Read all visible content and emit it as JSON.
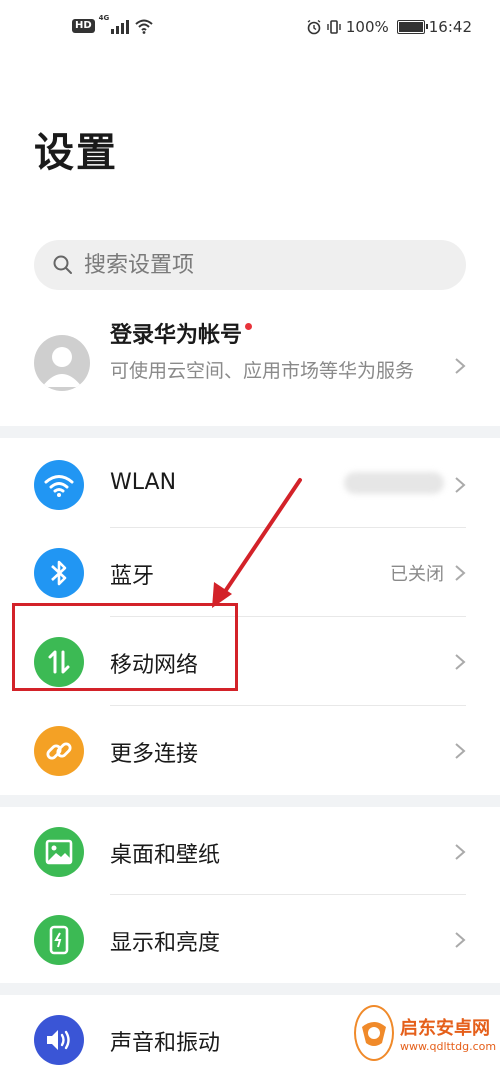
{
  "status_bar": {
    "hd": "HD",
    "network": "4G",
    "battery": "100%",
    "time": "16:42"
  },
  "page": {
    "title": "设置"
  },
  "search": {
    "placeholder": "搜索设置项"
  },
  "account": {
    "title": "登录华为帐号",
    "subtitle": "可使用云空间、应用市场等华为服务"
  },
  "settings_groups": [
    {
      "items": [
        {
          "label": "WLAN",
          "value": "",
          "icon": "wifi-icon",
          "color": "#2196f3"
        },
        {
          "label": "蓝牙",
          "value": "已关闭",
          "icon": "bluetooth-icon",
          "color": "#2196f3"
        },
        {
          "label": "移动网络",
          "value": "",
          "icon": "mobile-data-icon",
          "color": "#3cba54"
        },
        {
          "label": "更多连接",
          "value": "",
          "icon": "link-icon",
          "color": "#f4a125"
        }
      ]
    },
    {
      "items": [
        {
          "label": "桌面和壁纸",
          "value": "",
          "icon": "image-icon",
          "color": "#3cba54"
        },
        {
          "label": "显示和亮度",
          "value": "",
          "icon": "phone-display-icon",
          "color": "#3cba54"
        }
      ]
    },
    {
      "items": [
        {
          "label": "声音和振动",
          "value": "",
          "icon": "speaker-icon",
          "color": "#3a55d6"
        }
      ]
    }
  ],
  "watermark": {
    "title": "启东安卓网",
    "url": "www.qdlttdg.com"
  },
  "colors": {
    "annotation": "#d32229",
    "divider": "#f1f3f5"
  }
}
